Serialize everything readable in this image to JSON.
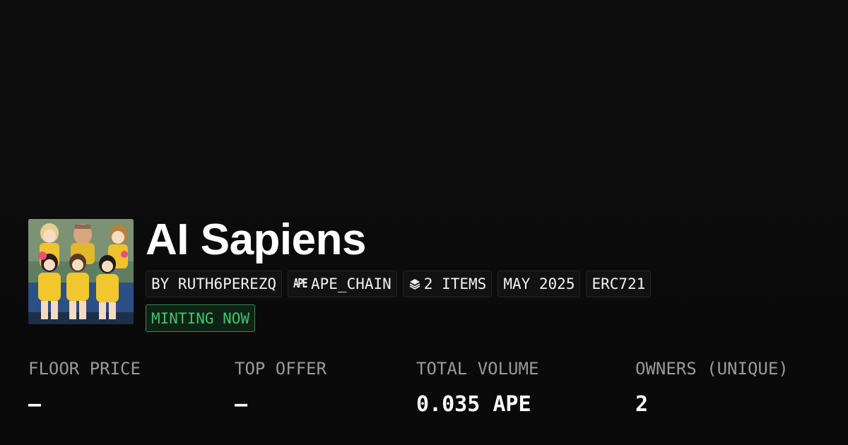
{
  "collection": {
    "name": "AI Sapiens"
  },
  "tags": {
    "creator": "BY RUTH6PEREZQ",
    "chain_icon": "ape-chain-icon",
    "chain": "APE_CHAIN",
    "items_icon": "layers-icon",
    "items": "2 ITEMS",
    "date": "MAY 2025",
    "standard": "ERC721"
  },
  "status": {
    "label": "MINTING NOW",
    "color": "#41c46b"
  },
  "stats": [
    {
      "label": "FLOOR PRICE",
      "value": "–"
    },
    {
      "label": "TOP OFFER",
      "value": "–"
    },
    {
      "label": "TOTAL VOLUME",
      "value": "0.035 APE"
    },
    {
      "label": "OWNERS (UNIQUE)",
      "value": "2"
    }
  ],
  "colors": {
    "background": "#0b0b0b",
    "label_gray": "#9a9a9a",
    "tag_border": "#262626",
    "status_green": "#41c46b"
  }
}
